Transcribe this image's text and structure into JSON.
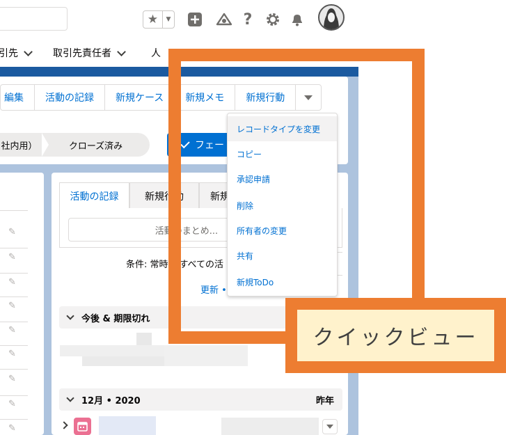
{
  "nav": {
    "items": [
      {
        "label": "引先",
        "has_dropdown": true
      },
      {
        "label": "取引先責任者",
        "has_dropdown": true
      },
      {
        "label": "人",
        "has_dropdown": false
      }
    ]
  },
  "actions": [
    "編集",
    "活動の記録",
    "新規ケース",
    "新規メモ",
    "新規行動"
  ],
  "path": {
    "stage1": "社内用）",
    "stage2": "クローズ済み",
    "phase_button": "フェー"
  },
  "activity": {
    "tabs": [
      "活動の記録",
      "新規行動",
      "新規"
    ],
    "summary_placeholder": "活動のまとめ...",
    "filter_text": "条件: 常時 • すべての活",
    "links": "更新 •",
    "section_upcoming": "今後 & 期限切れ",
    "section_month": "12月 • 2020",
    "section_month_right": "昨年"
  },
  "dropdown": {
    "items": [
      "レコードタイプを変更",
      "コピー",
      "承認申請",
      "削除",
      "所有者の変更",
      "共有",
      "新規ToDo"
    ]
  },
  "annotation": {
    "label": "クイックビュー",
    "color": "#ed7d31",
    "fill": "#fff2cc"
  },
  "colors": {
    "brand_blue": "#0070d2",
    "page_bg_blue": "#adc3de"
  },
  "icons": {
    "favorites": "star-icon",
    "new": "plus-icon",
    "trailhead": "trailhead-icon",
    "help": "question-icon",
    "settings": "gear-icon",
    "notifications": "bell-icon"
  }
}
